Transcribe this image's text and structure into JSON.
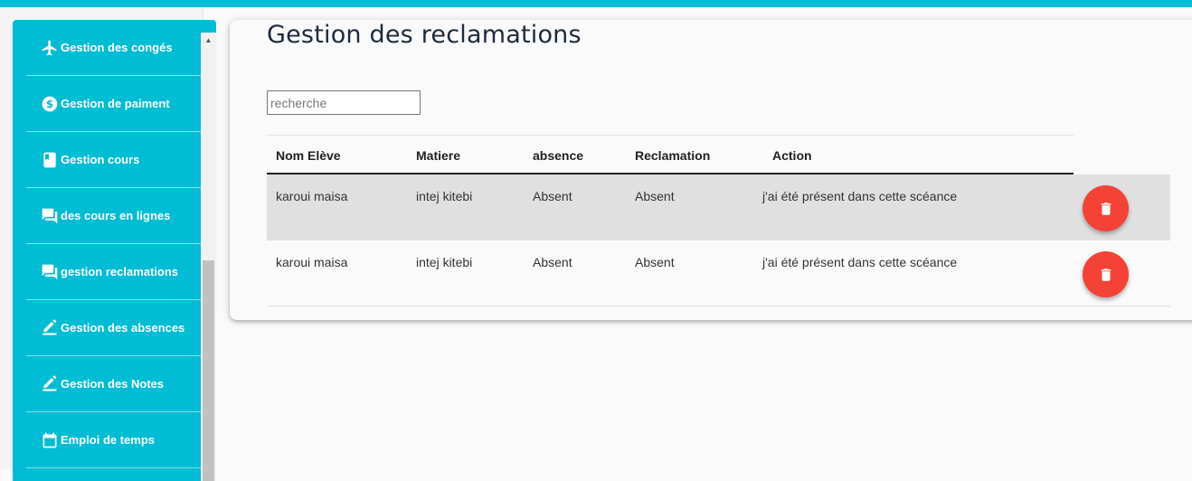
{
  "sidebar": {
    "items": [
      {
        "label": "Gestion des congés",
        "icon": "airplane-icon"
      },
      {
        "label": "Gestion de paiment",
        "icon": "dollar-icon"
      },
      {
        "label": "Gestion cours",
        "icon": "book-icon"
      },
      {
        "label": "des cours en lignes",
        "icon": "forum-icon"
      },
      {
        "label": "gestion reclamations",
        "icon": "forum-icon"
      },
      {
        "label": "Gestion des absences",
        "icon": "edit-icon"
      },
      {
        "label": "Gestion des Notes",
        "icon": "edit-icon"
      },
      {
        "label": "Emploi de temps",
        "icon": "calendar-icon"
      }
    ]
  },
  "page": {
    "title": "Gestion des reclamations",
    "search_placeholder": "recherche"
  },
  "table": {
    "headers": [
      "Nom Elève",
      "Matiere",
      "absence",
      "Reclamation",
      "Action"
    ],
    "rows": [
      {
        "nom": "karoui maisa",
        "matiere": "intej kitebi",
        "absence": "Absent",
        "reclamation": "Absent",
        "action": "j'ai été présent dans cette scéance"
      },
      {
        "nom": "karoui maisa",
        "matiere": "intej kitebi",
        "absence": "Absent",
        "reclamation": "Absent",
        "action": "j'ai été présent dans cette scéance"
      }
    ]
  },
  "colors": {
    "accent": "#00bcd4",
    "delete": "#f44336"
  }
}
